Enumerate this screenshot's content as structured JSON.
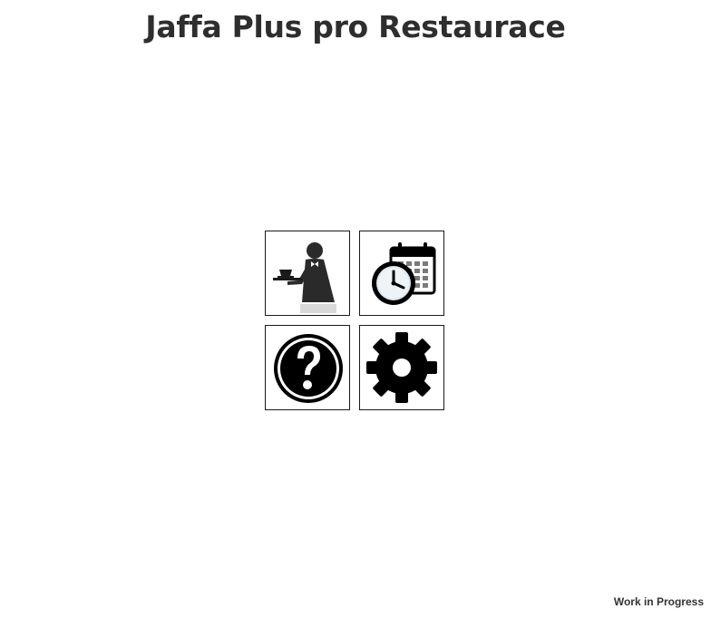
{
  "header": {
    "title": "Jaffa Plus pro Restaurace"
  },
  "tiles": [
    {
      "icon": "waiter-icon"
    },
    {
      "icon": "calendar-clock-icon"
    },
    {
      "icon": "help-icon"
    },
    {
      "icon": "gear-icon"
    }
  ],
  "footer": {
    "status": "Work in Progress"
  }
}
